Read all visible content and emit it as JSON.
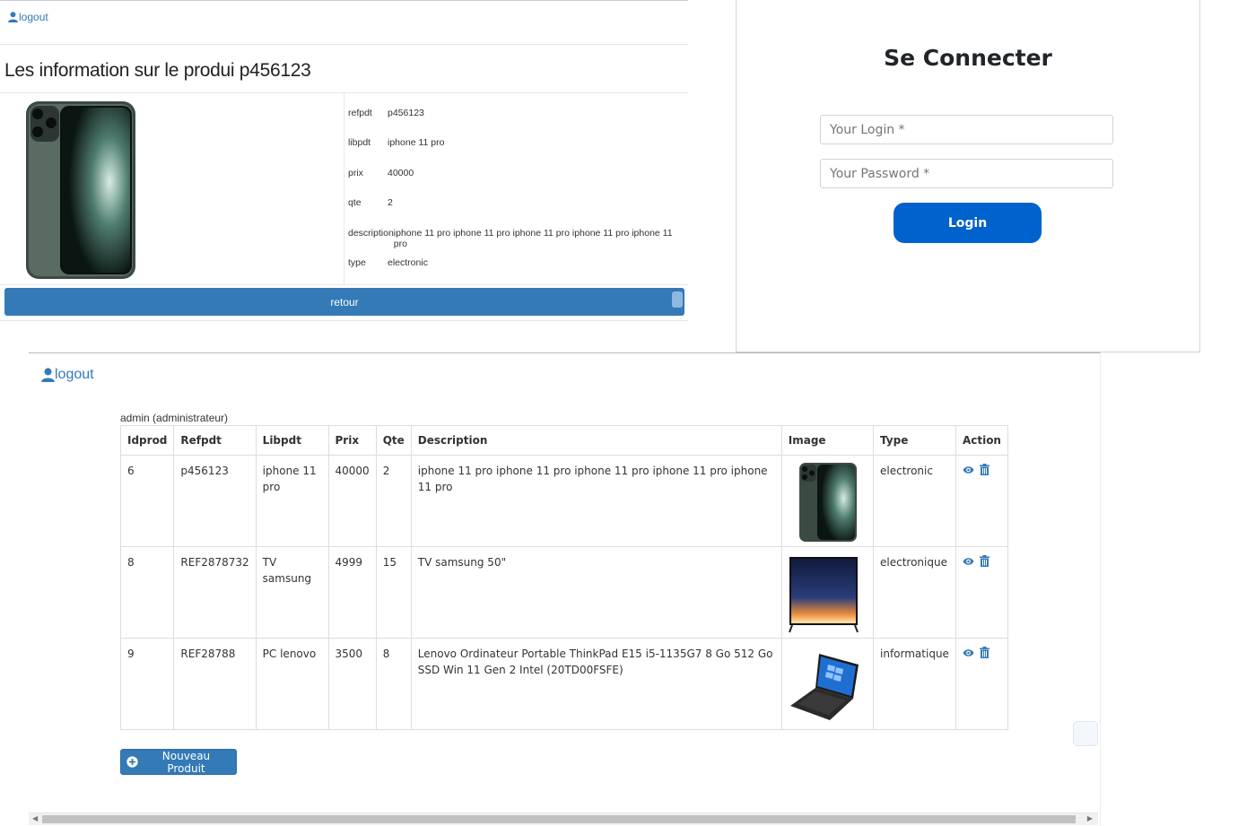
{
  "detail": {
    "logout_label": "logout",
    "title": "Les information sur le produi p456123",
    "fields": [
      {
        "key": "refpdt",
        "value": "p456123"
      },
      {
        "key": "libpdt",
        "value": "iphone 11 pro"
      },
      {
        "key": "prix",
        "value": "40000"
      },
      {
        "key": "qte",
        "value": "2"
      },
      {
        "key": "description",
        "value": "iphone 11 pro iphone 11 pro iphone 11 pro iphone 11 pro iphone 11 pro"
      },
      {
        "key": "type",
        "value": "electronic"
      }
    ],
    "retour_label": "retour"
  },
  "login": {
    "title": "Se Connecter",
    "login_placeholder": "Your Login *",
    "password_placeholder": "Your Password *",
    "button_label": "Login"
  },
  "list": {
    "logout_label": "logout",
    "user_label": "admin (administrateur)",
    "columns": [
      "Idprod",
      "Refpdt",
      "Libpdt",
      "Prix",
      "Qte",
      "Description",
      "Image",
      "Type",
      "Action"
    ],
    "rows": [
      {
        "idprod": "6",
        "refpdt": "p456123",
        "libpdt": "iphone 11 pro",
        "prix": "40000",
        "qte": "2",
        "description": "iphone 11 pro iphone 11 pro iphone 11 pro iphone 11 pro iphone 11 pro",
        "image": "phone",
        "type": "electronic"
      },
      {
        "idprod": "8",
        "refpdt": "REF2878732",
        "libpdt": "TV samsung",
        "prix": "4999",
        "qte": "15",
        "description": "TV samsung 50\"",
        "image": "tv",
        "type": "electronique"
      },
      {
        "idprod": "9",
        "refpdt": "REF28788",
        "libpdt": "PC lenovo",
        "prix": "3500",
        "qte": "8",
        "description": "Lenovo Ordinateur Portable ThinkPad E15 i5-1135G7 8 Go 512 Go SSD Win 11 Gen 2 Intel (20TD00FSFE)",
        "image": "laptop",
        "type": "informatique"
      }
    ],
    "new_button_label": "Nouveau Produit"
  },
  "colors": {
    "link": "#337ab7",
    "primary": "#337ab7",
    "login_button": "#0062cc"
  }
}
